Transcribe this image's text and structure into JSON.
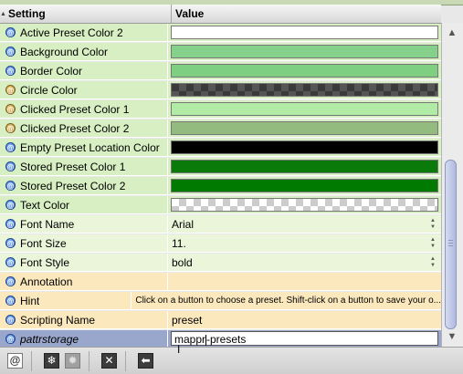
{
  "header": {
    "setting_label": "Setting",
    "value_label": "Value"
  },
  "rows": [
    {
      "label": "Active Preset Color 2",
      "icon": "at-icon",
      "kind": "swatch",
      "color": "#ffffff",
      "bg": "#d7efc2"
    },
    {
      "label": "Background Color",
      "icon": "at-icon",
      "kind": "swatch",
      "color": "#85d08a",
      "bg": "#d7efc2"
    },
    {
      "label": "Border Color",
      "icon": "at-icon",
      "kind": "swatch",
      "color": "#7fcf82",
      "bg": "#d7efc2"
    },
    {
      "label": "Circle Color",
      "icon": "at-icon-gold",
      "kind": "swatch-dark-checker",
      "color": "#3a3a3a",
      "bg": "#d7efc2"
    },
    {
      "label": "Clicked Preset Color 1",
      "icon": "at-icon-gold",
      "kind": "swatch",
      "color": "#b1eba6",
      "bg": "#d7efc2"
    },
    {
      "label": "Clicked Preset Color 2",
      "icon": "at-icon-gold",
      "kind": "swatch",
      "color": "#93bb7f",
      "bg": "#d7efc2"
    },
    {
      "label": "Empty Preset Location Color",
      "icon": "at-icon",
      "kind": "swatch",
      "color": "#000000",
      "bg": "#d7efc2"
    },
    {
      "label": "Stored Preset Color 1",
      "icon": "at-icon",
      "kind": "swatch",
      "color": "#0a7a0a",
      "bg": "#d7efc2"
    },
    {
      "label": "Stored Preset Color 2",
      "icon": "at-icon",
      "kind": "swatch",
      "color": "#007a00",
      "bg": "#d7efc2"
    },
    {
      "label": "Text Color",
      "icon": "at-icon",
      "kind": "swatch-checker",
      "color": "#ffffff",
      "bg": "#d7efc2"
    },
    {
      "label": "Font Name",
      "icon": "at-icon",
      "kind": "menu",
      "value": "Arial",
      "bg": "#eaf5da"
    },
    {
      "label": "Font Size",
      "icon": "at-icon",
      "kind": "menu",
      "value": "11.",
      "bg": "#eaf5da"
    },
    {
      "label": "Font Style",
      "icon": "at-icon",
      "kind": "menu",
      "value": "bold",
      "bg": "#eaf5da"
    },
    {
      "label": "Annotation",
      "icon": "at-icon",
      "kind": "text",
      "value": "",
      "bg": "#fbe8bd"
    },
    {
      "label": "Hint",
      "icon": "at-icon",
      "kind": "text-small",
      "value": "Click on a button to choose a preset. Shift-click on a button to save your o...",
      "bg": "#fbe8bd"
    },
    {
      "label": "Scripting Name",
      "icon": "at-icon",
      "kind": "text",
      "value": "preset",
      "bg": "#fbe8bd"
    },
    {
      "label": "pattrstorage",
      "icon": "at-icon",
      "kind": "editing",
      "value_before": "mappr",
      "value_after": "-presets",
      "bg": "#9aa7cc",
      "italic": true
    }
  ],
  "toolbar": {
    "at_label": "@",
    "freeze_icon": "snowflake-icon",
    "gear_icon": "gear-icon",
    "close_label": "✕",
    "back_label": "⬅"
  },
  "cursor": "I-beam",
  "colors": {
    "header_bg": "#e0e0e0",
    "selected_row": "#9aa7cc",
    "scroll_thumb": "#aeb9dd"
  }
}
